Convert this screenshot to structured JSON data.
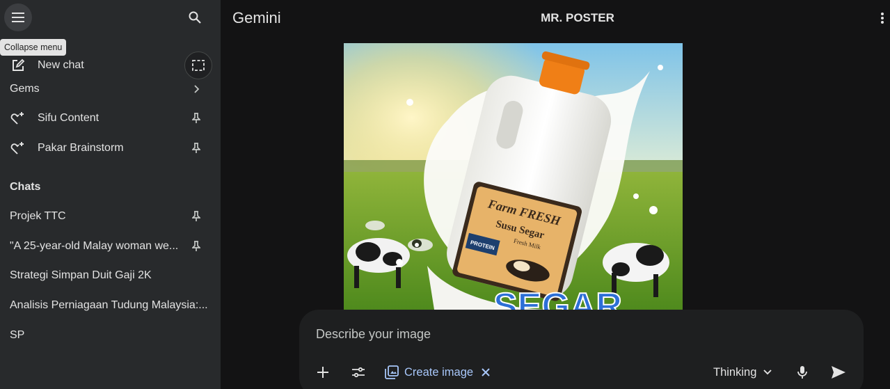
{
  "sidebar": {
    "tooltip": "Collapse menu",
    "new_chat": "New chat",
    "gems_title": "Gems",
    "gems": [
      {
        "label": "Sifu Content",
        "icon": "gem-sparkle-icon",
        "pinned": true
      },
      {
        "label": "Pakar Brainstorm",
        "icon": "gem-sparkle-icon",
        "pinned": true
      }
    ],
    "chats_title": "Chats",
    "chats": [
      {
        "label": "Projek TTC",
        "pinned": true
      },
      {
        "label": "\"A 25-year-old Malay woman we...",
        "pinned": true
      },
      {
        "label": "Strategi Simpan Duit Gaji 2K",
        "pinned": false
      },
      {
        "label": "Analisis Perniagaan Tudung Malaysia:...",
        "pinned": false
      },
      {
        "label": "SP",
        "pinned": false
      }
    ]
  },
  "header": {
    "brand": "Gemini",
    "chat_title": "MR. POSTER"
  },
  "poster": {
    "label_brand": "Farm FRESH",
    "label_product": "Susu Segar",
    "label_sub": "Fresh Milk",
    "label_protein": "PROTEIN",
    "banner_text": "SEGAR"
  },
  "composer": {
    "placeholder": "Describe your image",
    "create_image_label": "Create image",
    "model_label": "Thinking"
  },
  "colors": {
    "sidebar_bg": "#282a2c",
    "main_bg": "#131314",
    "composer_bg": "#1e1f20",
    "accent": "#a8c7fa"
  }
}
